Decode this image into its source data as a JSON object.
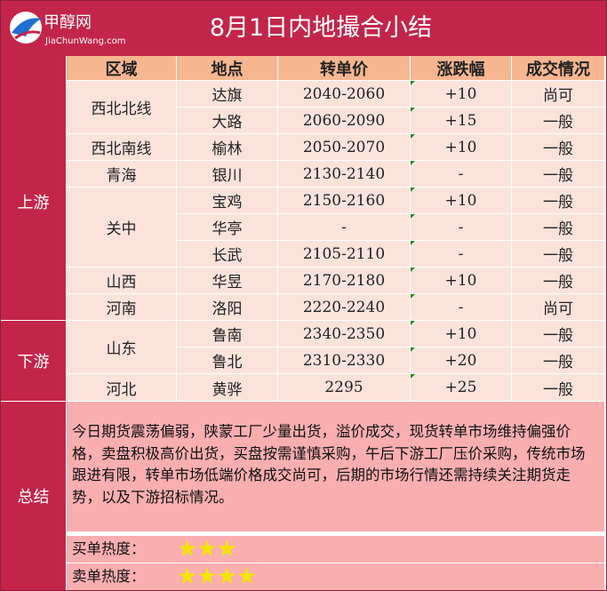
{
  "header": {
    "logo_text": "甲醇网",
    "logo_url_text": "JiaChunWang.com",
    "title": "8月1日内地撮合小结"
  },
  "table": {
    "columns": [
      "区域",
      "地点",
      "转单价",
      "涨跌幅",
      "成交情况"
    ],
    "side_labels": {
      "upstream": "上游",
      "downstream": "下游",
      "summary": "总结"
    },
    "regions": [
      {
        "name": "西北北线"
      },
      {
        "name": "西北南线"
      },
      {
        "name": "青海"
      },
      {
        "name": "关中"
      },
      {
        "name": "山西"
      },
      {
        "name": "河南"
      },
      {
        "name": "山东"
      },
      {
        "name": "河北"
      }
    ],
    "rows": [
      {
        "location": "达旗",
        "price": "2040-2060",
        "change": "+10",
        "status": "尚可"
      },
      {
        "location": "大路",
        "price": "2060-2090",
        "change": "+15",
        "status": "一般"
      },
      {
        "location": "榆林",
        "price": "2050-2070",
        "change": "+10",
        "status": "一般"
      },
      {
        "location": "银川",
        "price": "2130-2140",
        "change": "-",
        "status": "一般"
      },
      {
        "location": "宝鸡",
        "price": "2150-2160",
        "change": "+10",
        "status": "一般"
      },
      {
        "location": "华亭",
        "price": "-",
        "change": "-",
        "status": "一般"
      },
      {
        "location": "长武",
        "price": "2105-2110",
        "change": "-",
        "status": "一般"
      },
      {
        "location": "华昱",
        "price": "2170-2180",
        "change": "+10",
        "status": "一般"
      },
      {
        "location": "洛阳",
        "price": "2220-2240",
        "change": "-",
        "status": "尚可"
      },
      {
        "location": "鲁南",
        "price": "2340-2350",
        "change": "+10",
        "status": "一般"
      },
      {
        "location": "鲁北",
        "price": "2310-2330",
        "change": "+20",
        "status": "一般"
      },
      {
        "location": "黄骅",
        "price": "2295",
        "change": "+25",
        "status": "一般"
      }
    ]
  },
  "summary": {
    "text": "今日期货震荡偏弱，陕蒙工厂少量出货，溢价成交，现货转单市场维持偏强价格，卖盘积极高价出货，买盘按需谨慎采购，午后下游工厂压价采购，传统市场跟进有限，转单市场低端价格成交尚可，后期的市场行情还需持续关注期货走势，以及下游招标情况。",
    "buy_heat_label": "买单热度：",
    "buy_heat_stars": 3,
    "sell_heat_label": "卖单热度：",
    "sell_heat_stars": 4,
    "star_color": "#f4e400"
  },
  "colors": {
    "brand": "#c3254a",
    "header_cell": "#f6b690",
    "row_bg": "#fbe3dc",
    "summary_bg": "#f9aeb0"
  }
}
